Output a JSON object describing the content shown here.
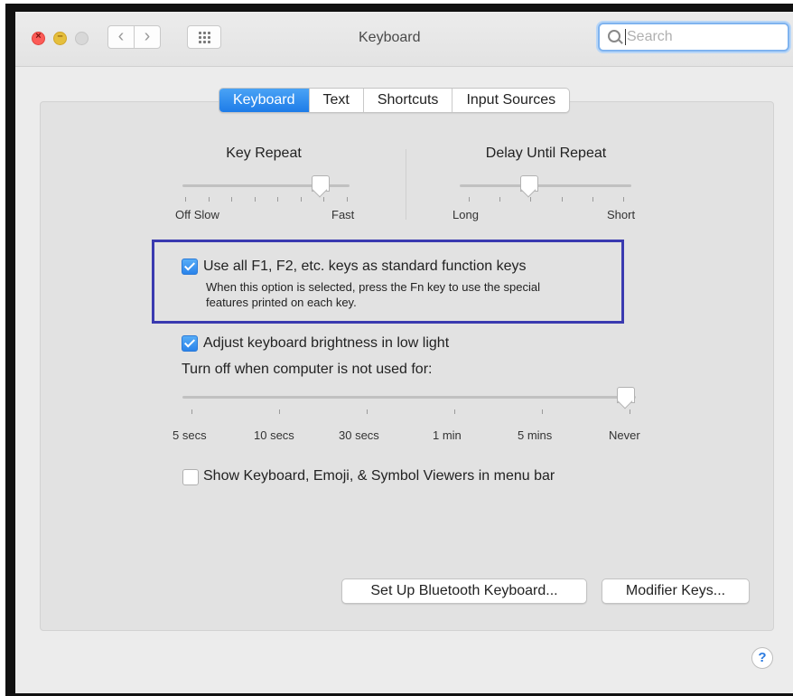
{
  "window": {
    "title": "Keyboard",
    "search_placeholder": "Search"
  },
  "tabs": [
    {
      "label": "Keyboard",
      "active": true
    },
    {
      "label": "Text",
      "active": false
    },
    {
      "label": "Shortcuts",
      "active": false
    },
    {
      "label": "Input Sources",
      "active": false
    }
  ],
  "key_repeat": {
    "title": "Key Repeat",
    "min_label": "Off Slow",
    "max_label": "Fast",
    "level": 0.82
  },
  "delay_until_repeat": {
    "title": "Delay Until Repeat",
    "min_label": "Long",
    "max_label": "Short",
    "level": 0.4
  },
  "function_keys": {
    "label": "Use all F1, F2, etc. keys as standard function keys",
    "checked": true,
    "note_line1": "When this option is selected, press the Fn key to use the special",
    "note_line2": "features printed on each key."
  },
  "brightness": {
    "label": "Adjust keyboard brightness in low light",
    "checked": true
  },
  "turn_off": {
    "label": "Turn off when computer is not used for:",
    "ticks": [
      "5 secs",
      "10 secs",
      "30 secs",
      "1 min",
      "5 mins",
      "Never"
    ],
    "selected": "Never"
  },
  "viewers": {
    "label": "Show Keyboard, Emoji, & Symbol Viewers in menu bar",
    "checked": false
  },
  "buttons": {
    "bluetooth": "Set Up Bluetooth Keyboard...",
    "modifier": "Modifier Keys..."
  },
  "help_label": "?",
  "colors": {
    "accent": "#2a83ea",
    "highlight_box": "#3a3ab0"
  }
}
